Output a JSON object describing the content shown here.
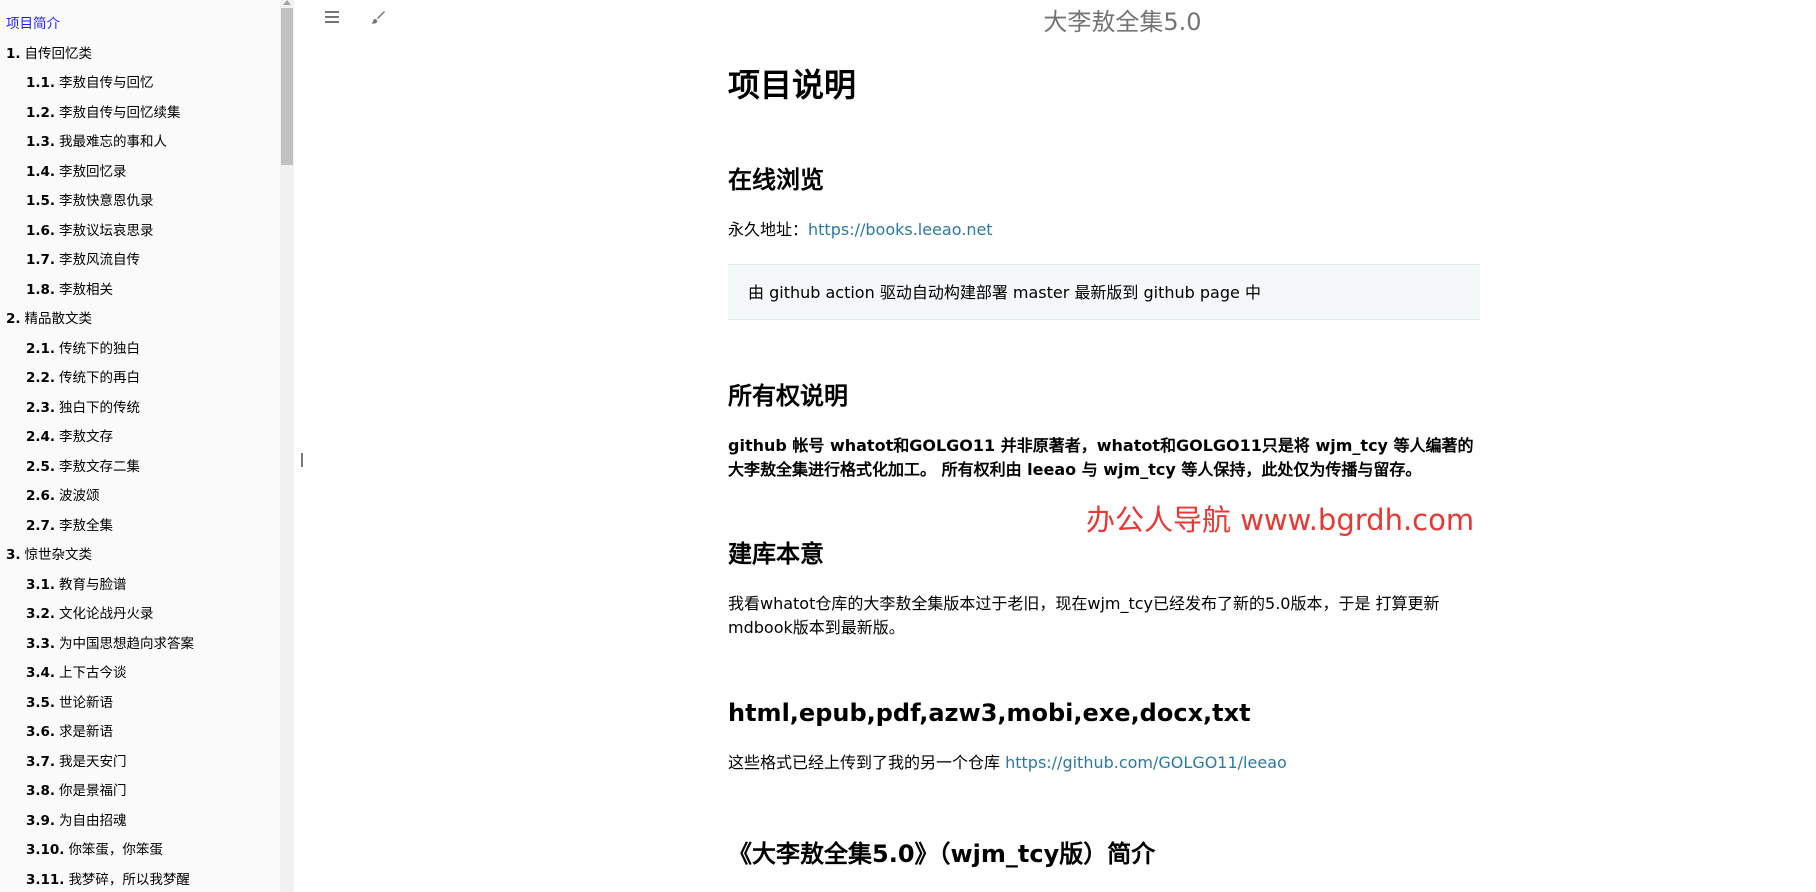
{
  "book_title": "大李敖全集5.0",
  "sidebar": {
    "items": [
      {
        "number": "",
        "label": "项目简介",
        "level": 0,
        "active": true
      },
      {
        "number": "1.",
        "label": "自传回忆类",
        "level": 0
      },
      {
        "number": "1.1.",
        "label": "李敖自传与回忆",
        "level": 1
      },
      {
        "number": "1.2.",
        "label": "李敖自传与回忆续集",
        "level": 1
      },
      {
        "number": "1.3.",
        "label": "我最难忘的事和人",
        "level": 1
      },
      {
        "number": "1.4.",
        "label": "李敖回忆录",
        "level": 1
      },
      {
        "number": "1.5.",
        "label": "李敖快意恩仇录",
        "level": 1
      },
      {
        "number": "1.6.",
        "label": "李敖议坛哀思录",
        "level": 1
      },
      {
        "number": "1.7.",
        "label": "李敖风流自传",
        "level": 1
      },
      {
        "number": "1.8.",
        "label": "李敖相关",
        "level": 1
      },
      {
        "number": "2.",
        "label": "精品散文类",
        "level": 0
      },
      {
        "number": "2.1.",
        "label": "传统下的独白",
        "level": 1
      },
      {
        "number": "2.2.",
        "label": "传统下的再白",
        "level": 1
      },
      {
        "number": "2.3.",
        "label": "独白下的传统",
        "level": 1
      },
      {
        "number": "2.4.",
        "label": "李敖文存",
        "level": 1
      },
      {
        "number": "2.5.",
        "label": "李敖文存二集",
        "level": 1
      },
      {
        "number": "2.6.",
        "label": "波波颂",
        "level": 1
      },
      {
        "number": "2.7.",
        "label": "李敖全集",
        "level": 1
      },
      {
        "number": "3.",
        "label": "惊世杂文类",
        "level": 0
      },
      {
        "number": "3.1.",
        "label": "教育与脸谱",
        "level": 1
      },
      {
        "number": "3.2.",
        "label": "文化论战丹火录",
        "level": 1
      },
      {
        "number": "3.3.",
        "label": "为中国思想趋向求答案",
        "level": 1
      },
      {
        "number": "3.4.",
        "label": "上下古今谈",
        "level": 1
      },
      {
        "number": "3.5.",
        "label": "世论新语",
        "level": 1
      },
      {
        "number": "3.6.",
        "label": "求是新语",
        "level": 1
      },
      {
        "number": "3.7.",
        "label": "我是天安门",
        "level": 1
      },
      {
        "number": "3.8.",
        "label": "你是景福门",
        "level": 1
      },
      {
        "number": "3.9.",
        "label": "为自由招魂",
        "level": 1
      },
      {
        "number": "3.10.",
        "label": "你笨蛋，你笨蛋",
        "level": 1
      },
      {
        "number": "3.11.",
        "label": "我梦碎，所以我梦醒",
        "level": 1
      }
    ]
  },
  "content": {
    "h1": "项目说明",
    "sections": {
      "online": {
        "heading": "在线浏览",
        "permalink_prefix": "永久地址：",
        "permalink_url": "https://books.leeao.net",
        "blockquote": "由 github action 驱动自动构建部署 master 最新版到 github page 中"
      },
      "ownership": {
        "heading": "所有权说明",
        "text": "github 帐号 whatot和GOLGO11 并非原著者，whatot和GOLGO11只是将 wjm_tcy 等人编著的大李敖全集进行格式化加工。 所有权利由 leeao 与 wjm_tcy 等人保持，此处仅为传播与留存。"
      },
      "purpose": {
        "heading": "建库本意",
        "text": "我看whatot仓库的大李敖全集版本过于老旧，现在wjm_tcy已经发布了新的5.0版本，于是 打算更新mdbook版本到最新版。"
      },
      "formats": {
        "heading": "html,epub,pdf,azw3,mobi,exe,docx,txt",
        "text_prefix": "这些格式已经上传到了我的另一个仓库 ",
        "repo_url": "https://github.com/GOLGO11/leeao"
      },
      "intro": {
        "heading": "《大李敖全集5.0》（wjm_tcy版）简介"
      }
    },
    "watermark": "办公人导航 www.bgrdh.com"
  },
  "icons": {
    "menu": "hamburger-icon",
    "theme": "paintbrush-icon"
  },
  "colors": {
    "link": "#2b79a2",
    "active_sidebar": "#1f1fff",
    "watermark": "#e53935",
    "blockquote_bg": "#f4f8f9"
  }
}
